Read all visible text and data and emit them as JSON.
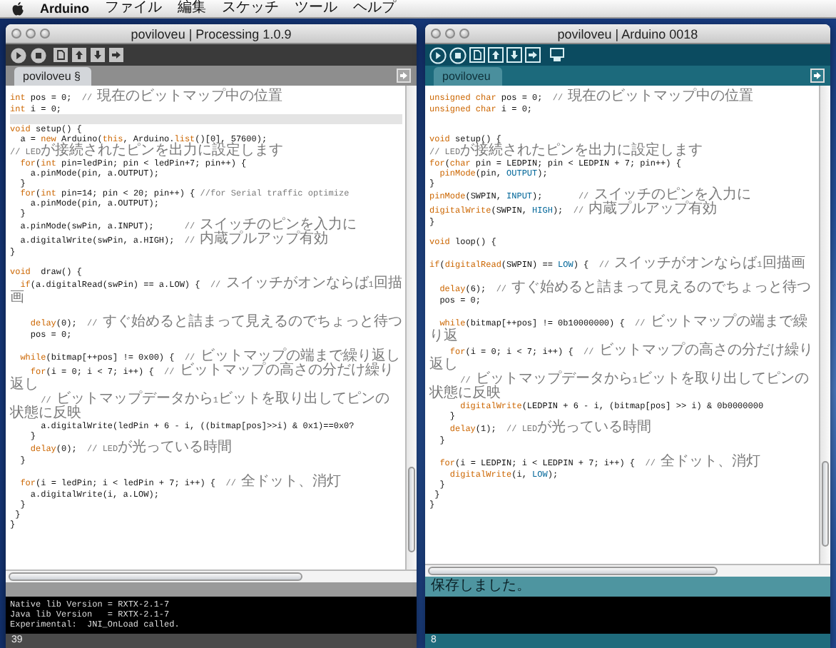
{
  "menu_bar": {
    "app": "Arduino",
    "items": [
      "ファイル",
      "編集",
      "スケッチ",
      "ツール",
      "ヘルプ"
    ]
  },
  "windows": [
    {
      "kind": "processing",
      "title": "poviloveu | Processing 1.0.9",
      "tabs": [
        {
          "label": "poviloveu §",
          "selected": true
        }
      ],
      "lines": [
        {
          "kind": "code",
          "highlighted": false,
          "segments": [
            {
              "kind": "keyword",
              "text": "int"
            },
            {
              "kind": "text",
              "text": " pos = 0;  "
            },
            {
              "kind": "comment",
              "text": "// 現在のビットマップ中の位置"
            }
          ]
        },
        {
          "kind": "code",
          "highlighted": false,
          "segments": [
            {
              "kind": "keyword",
              "text": "int"
            },
            {
              "kind": "text",
              "text": " i = 0;"
            }
          ]
        },
        {
          "kind": "blank",
          "highlighted": true
        },
        {
          "kind": "code",
          "highlighted": false,
          "segments": [
            {
              "kind": "keyword",
              "text": "void"
            },
            {
              "kind": "text",
              "text": " setup() {"
            }
          ]
        },
        {
          "kind": "code",
          "highlighted": false,
          "segments": [
            {
              "kind": "text",
              "text": "  a = "
            },
            {
              "kind": "keyword",
              "text": "new"
            },
            {
              "kind": "text",
              "text": " Arduino("
            },
            {
              "kind": "keyword",
              "text": "this"
            },
            {
              "kind": "text",
              "text": ", Arduino."
            },
            {
              "kind": "keyword",
              "text": "list"
            },
            {
              "kind": "text",
              "text": "()[0], 57600);"
            }
          ]
        },
        {
          "kind": "code",
          "highlighted": false,
          "segments": [
            {
              "kind": "comment",
              "text": "// LEDが接続されたピンを出力に設定します"
            }
          ]
        },
        {
          "kind": "code",
          "highlighted": false,
          "segments": [
            {
              "kind": "keyword",
              "text": "  for"
            },
            {
              "kind": "text",
              "text": "("
            },
            {
              "kind": "keyword",
              "text": "int"
            },
            {
              "kind": "text",
              "text": " pin=ledPin; pin < ledPin+7; pin++) {"
            }
          ]
        },
        {
          "kind": "code",
          "highlighted": false,
          "segments": [
            {
              "kind": "text",
              "text": "    a.pinMode(pin, a.OUTPUT);"
            }
          ]
        },
        {
          "kind": "code",
          "highlighted": false,
          "segments": [
            {
              "kind": "text",
              "text": "  }"
            }
          ]
        },
        {
          "kind": "code",
          "highlighted": false,
          "segments": [
            {
              "kind": "keyword",
              "text": "  for"
            },
            {
              "kind": "text",
              "text": "("
            },
            {
              "kind": "keyword",
              "text": "int"
            },
            {
              "kind": "text",
              "text": " pin=14; pin < 20; pin++) { "
            },
            {
              "kind": "comment",
              "text": "//for Serial traffic optimize"
            }
          ]
        },
        {
          "kind": "code",
          "highlighted": false,
          "segments": [
            {
              "kind": "text",
              "text": "    a.pinMode(pin, a.OUTPUT);"
            }
          ]
        },
        {
          "kind": "code",
          "highlighted": false,
          "segments": [
            {
              "kind": "text",
              "text": "  }"
            }
          ]
        },
        {
          "kind": "code",
          "highlighted": false,
          "segments": [
            {
              "kind": "text",
              "text": "  a.pinMode(swPin, a.INPUT);      "
            },
            {
              "kind": "comment",
              "text": "// スイッチのピンを入力に"
            }
          ]
        },
        {
          "kind": "code",
          "highlighted": false,
          "segments": [
            {
              "kind": "text",
              "text": "  a.digitalWrite(swPin, a.HIGH);  "
            },
            {
              "kind": "comment",
              "text": "// 内蔵プルアップ有効"
            }
          ]
        },
        {
          "kind": "code",
          "highlighted": false,
          "segments": [
            {
              "kind": "text",
              "text": "}"
            }
          ]
        },
        {
          "kind": "blank",
          "highlighted": false
        },
        {
          "kind": "code",
          "highlighted": false,
          "segments": [
            {
              "kind": "keyword",
              "text": "void"
            },
            {
              "kind": "text",
              "text": "  draw() {"
            }
          ]
        },
        {
          "kind": "code",
          "highlighted": false,
          "segments": [
            {
              "kind": "keyword",
              "text": "  if"
            },
            {
              "kind": "text",
              "text": "(a.digitalRead(swPin) == a.LOW) {  "
            },
            {
              "kind": "comment",
              "text": "// スイッチがオンならば1回描画"
            }
          ]
        },
        {
          "kind": "blank",
          "highlighted": false
        },
        {
          "kind": "code",
          "highlighted": false,
          "segments": [
            {
              "kind": "keyword",
              "text": "    delay"
            },
            {
              "kind": "text",
              "text": "(0);  "
            },
            {
              "kind": "comment",
              "text": "// すぐ始めると詰まって見えるのでちょっと待つ"
            }
          ]
        },
        {
          "kind": "code",
          "highlighted": false,
          "segments": [
            {
              "kind": "text",
              "text": "    pos = 0;"
            }
          ]
        },
        {
          "kind": "blank",
          "highlighted": false
        },
        {
          "kind": "code",
          "highlighted": false,
          "segments": [
            {
              "kind": "keyword",
              "text": "  while"
            },
            {
              "kind": "text",
              "text": "(bitmap[++pos] != 0x00) {  "
            },
            {
              "kind": "comment",
              "text": "// ビットマップの端まで繰り返し"
            }
          ]
        },
        {
          "kind": "code",
          "highlighted": false,
          "segments": [
            {
              "kind": "keyword",
              "text": "    for"
            },
            {
              "kind": "text",
              "text": "(i = 0; i < 7; i++) {  "
            },
            {
              "kind": "comment",
              "text": "// ビットマップの高さの分だけ繰り返し"
            }
          ]
        },
        {
          "kind": "code",
          "highlighted": false,
          "segments": [
            {
              "kind": "comment",
              "text": "      // ビットマップデータから1ビットを取り出してピンの状態に反映"
            }
          ]
        },
        {
          "kind": "code",
          "highlighted": false,
          "segments": [
            {
              "kind": "text",
              "text": "      a.digitalWrite(ledPin + 6 - i, ((bitmap[pos]>>i) & 0x1)==0x0?"
            }
          ]
        },
        {
          "kind": "code",
          "highlighted": false,
          "segments": [
            {
              "kind": "text",
              "text": "    }"
            }
          ]
        },
        {
          "kind": "code",
          "highlighted": false,
          "segments": [
            {
              "kind": "keyword",
              "text": "    delay"
            },
            {
              "kind": "text",
              "text": "(0);  "
            },
            {
              "kind": "comment",
              "text": "// LEDが光っている時間"
            }
          ]
        },
        {
          "kind": "code",
          "highlighted": false,
          "segments": [
            {
              "kind": "text",
              "text": "  }"
            }
          ]
        },
        {
          "kind": "blank",
          "highlighted": false
        },
        {
          "kind": "code",
          "highlighted": false,
          "segments": [
            {
              "kind": "keyword",
              "text": "  for"
            },
            {
              "kind": "text",
              "text": "(i = ledPin; i < ledPin + 7; i++) {  "
            },
            {
              "kind": "comment",
              "text": "// 全ドット、消灯"
            }
          ]
        },
        {
          "kind": "code",
          "highlighted": false,
          "segments": [
            {
              "kind": "text",
              "text": "    a.digitalWrite(i, a.LOW);"
            }
          ]
        },
        {
          "kind": "code",
          "highlighted": false,
          "segments": [
            {
              "kind": "text",
              "text": "  }"
            }
          ]
        },
        {
          "kind": "code",
          "highlighted": false,
          "segments": [
            {
              "kind": "text",
              "text": " }"
            }
          ]
        },
        {
          "kind": "code",
          "highlighted": false,
          "segments": [
            {
              "kind": "text",
              "text": "}"
            }
          ]
        }
      ],
      "console": [
        "Native lib Version = RXTX-2.1-7",
        "Java lib Version   = RXTX-2.1-7",
        "Experimental:  JNI_OnLoad called."
      ],
      "line_number": "39"
    },
    {
      "kind": "arduino",
      "title": "poviloveu | Arduino 0018",
      "tabs": [
        {
          "label": "poviloveu",
          "selected": true
        }
      ],
      "lines": [
        {
          "kind": "code",
          "highlighted": false,
          "segments": [
            {
              "kind": "keyword",
              "text": "unsigned char"
            },
            {
              "kind": "text",
              "text": " pos = 0;  "
            },
            {
              "kind": "comment",
              "text": "// 現在のビットマップ中の位置"
            }
          ]
        },
        {
          "kind": "code",
          "highlighted": false,
          "segments": [
            {
              "kind": "keyword",
              "text": "unsigned char"
            },
            {
              "kind": "text",
              "text": " i = 0;"
            }
          ]
        },
        {
          "kind": "blank",
          "highlighted": false
        },
        {
          "kind": "blank",
          "highlighted": false
        },
        {
          "kind": "code",
          "highlighted": false,
          "segments": [
            {
              "kind": "keyword",
              "text": "void"
            },
            {
              "kind": "text",
              "text": " setup() {"
            }
          ]
        },
        {
          "kind": "code",
          "highlighted": false,
          "segments": [
            {
              "kind": "comment",
              "text": "// LEDが接続されたピンを出力に設定します"
            }
          ]
        },
        {
          "kind": "code",
          "highlighted": false,
          "segments": [
            {
              "kind": "keyword",
              "text": "for"
            },
            {
              "kind": "text",
              "text": "("
            },
            {
              "kind": "keyword",
              "text": "char"
            },
            {
              "kind": "text",
              "text": " pin = LEDPIN; pin < LEDPIN + 7; pin++) {"
            }
          ]
        },
        {
          "kind": "code",
          "highlighted": false,
          "segments": [
            {
              "kind": "keyword",
              "text": "  pinMode"
            },
            {
              "kind": "text",
              "text": "(pin, "
            },
            {
              "kind": "constant",
              "text": "OUTPUT"
            },
            {
              "kind": "text",
              "text": ");"
            }
          ]
        },
        {
          "kind": "code",
          "highlighted": false,
          "segments": [
            {
              "kind": "text",
              "text": "}"
            }
          ]
        },
        {
          "kind": "code",
          "highlighted": false,
          "segments": [
            {
              "kind": "keyword",
              "text": "pinMode"
            },
            {
              "kind": "text",
              "text": "(SWPIN, "
            },
            {
              "kind": "constant",
              "text": "INPUT"
            },
            {
              "kind": "text",
              "text": ");       "
            },
            {
              "kind": "comment",
              "text": "// スイッチのピンを入力に"
            }
          ]
        },
        {
          "kind": "code",
          "highlighted": false,
          "segments": [
            {
              "kind": "keyword",
              "text": "digitalWrite"
            },
            {
              "kind": "text",
              "text": "(SWPIN, "
            },
            {
              "kind": "constant",
              "text": "HIGH"
            },
            {
              "kind": "text",
              "text": ");  "
            },
            {
              "kind": "comment",
              "text": "// 内蔵プルアップ有効"
            }
          ]
        },
        {
          "kind": "code",
          "highlighted": false,
          "segments": [
            {
              "kind": "text",
              "text": "}"
            }
          ]
        },
        {
          "kind": "blank",
          "highlighted": false
        },
        {
          "kind": "code",
          "highlighted": false,
          "segments": [
            {
              "kind": "keyword",
              "text": "void"
            },
            {
              "kind": "text",
              "text": " loop() {"
            }
          ]
        },
        {
          "kind": "blank",
          "highlighted": false
        },
        {
          "kind": "code",
          "highlighted": false,
          "segments": [
            {
              "kind": "keyword",
              "text": "if"
            },
            {
              "kind": "text",
              "text": "("
            },
            {
              "kind": "keyword",
              "text": "digitalRead"
            },
            {
              "kind": "text",
              "text": "(SWPIN) == "
            },
            {
              "kind": "constant",
              "text": "LOW"
            },
            {
              "kind": "text",
              "text": ") {  "
            },
            {
              "kind": "comment",
              "text": "// スイッチがオンならば1回描画"
            }
          ]
        },
        {
          "kind": "blank",
          "highlighted": false
        },
        {
          "kind": "code",
          "highlighted": false,
          "segments": [
            {
              "kind": "keyword",
              "text": "  delay"
            },
            {
              "kind": "text",
              "text": "(6);  "
            },
            {
              "kind": "comment",
              "text": "// すぐ始めると詰まって見えるのでちょっと待つ"
            }
          ]
        },
        {
          "kind": "code",
          "highlighted": false,
          "segments": [
            {
              "kind": "text",
              "text": "  pos = 0;"
            }
          ]
        },
        {
          "kind": "blank",
          "highlighted": false
        },
        {
          "kind": "code",
          "highlighted": false,
          "segments": [
            {
              "kind": "keyword",
              "text": "  while"
            },
            {
              "kind": "text",
              "text": "(bitmap[++pos] != 0b10000000) {  "
            },
            {
              "kind": "comment",
              "text": "// ビットマップの端まで繰り返"
            }
          ]
        },
        {
          "kind": "code",
          "highlighted": false,
          "segments": [
            {
              "kind": "keyword",
              "text": "    for"
            },
            {
              "kind": "text",
              "text": "(i = 0; i < 7; i++) {  "
            },
            {
              "kind": "comment",
              "text": "// ビットマップの高さの分だけ繰り返し"
            }
          ]
        },
        {
          "kind": "code",
          "highlighted": false,
          "segments": [
            {
              "kind": "comment",
              "text": "      // ビットマップデータから1ビットを取り出してピンの状態に反映"
            }
          ]
        },
        {
          "kind": "code",
          "highlighted": false,
          "segments": [
            {
              "kind": "keyword",
              "text": "      digitalWrite"
            },
            {
              "kind": "text",
              "text": "(LEDPIN + 6 - i, (bitmap[pos] >> i) & 0b0000000"
            }
          ]
        },
        {
          "kind": "code",
          "highlighted": false,
          "segments": [
            {
              "kind": "text",
              "text": "    }"
            }
          ]
        },
        {
          "kind": "code",
          "highlighted": false,
          "segments": [
            {
              "kind": "keyword",
              "text": "    delay"
            },
            {
              "kind": "text",
              "text": "(1);  "
            },
            {
              "kind": "comment",
              "text": "// LEDが光っている時間"
            }
          ]
        },
        {
          "kind": "code",
          "highlighted": false,
          "segments": [
            {
              "kind": "text",
              "text": "  }"
            }
          ]
        },
        {
          "kind": "blank",
          "highlighted": false
        },
        {
          "kind": "code",
          "highlighted": false,
          "segments": [
            {
              "kind": "keyword",
              "text": "  for"
            },
            {
              "kind": "text",
              "text": "(i = LEDPIN; i < LEDPIN + 7; i++) {  "
            },
            {
              "kind": "comment",
              "text": "// 全ドット、消灯"
            }
          ]
        },
        {
          "kind": "code",
          "highlighted": false,
          "segments": [
            {
              "kind": "keyword",
              "text": "    digitalWrite"
            },
            {
              "kind": "text",
              "text": "(i, "
            },
            {
              "kind": "constant",
              "text": "LOW"
            },
            {
              "kind": "text",
              "text": ");"
            }
          ]
        },
        {
          "kind": "code",
          "highlighted": false,
          "segments": [
            {
              "kind": "text",
              "text": "  }"
            }
          ]
        },
        {
          "kind": "code",
          "highlighted": false,
          "segments": [
            {
              "kind": "text",
              "text": " }"
            }
          ]
        },
        {
          "kind": "code",
          "highlighted": false,
          "segments": [
            {
              "kind": "text",
              "text": "}"
            }
          ]
        }
      ],
      "status": "保存しました。",
      "line_number": "8"
    }
  ]
}
